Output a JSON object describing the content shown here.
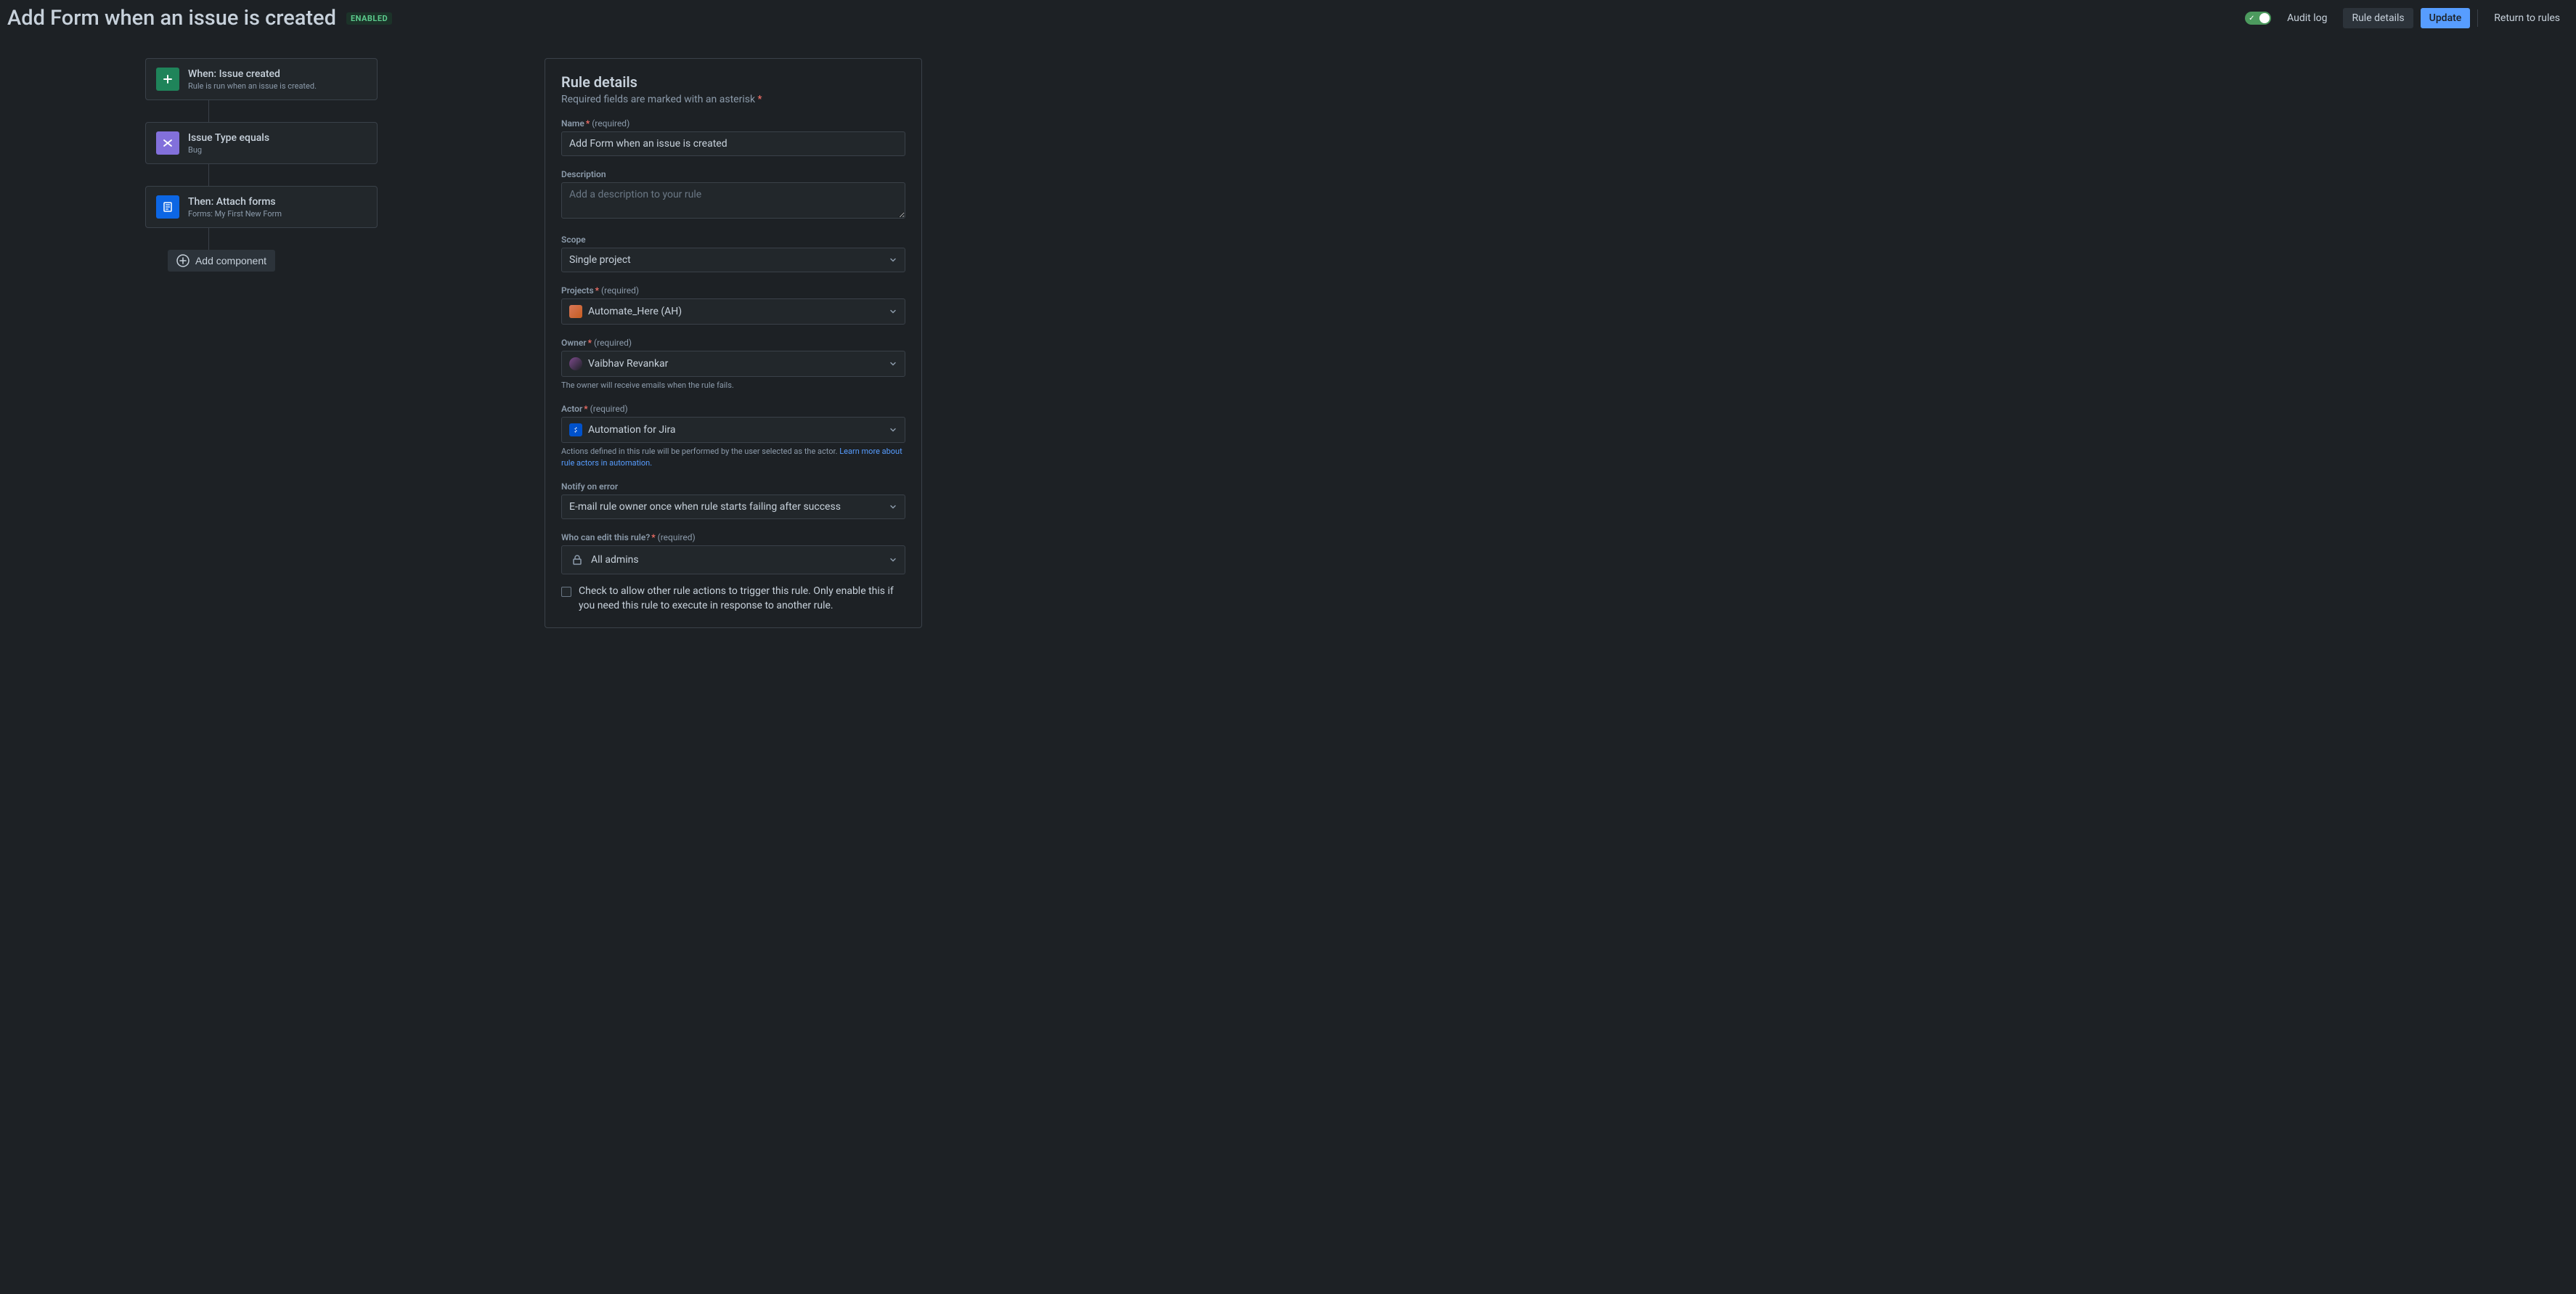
{
  "header": {
    "title": "Add Form when an issue is created",
    "enabled_badge": "ENABLED",
    "audit_log": "Audit log",
    "rule_details": "Rule details",
    "update": "Update",
    "return": "Return to rules"
  },
  "flow": {
    "trigger": {
      "title": "When: Issue created",
      "sub": "Rule is run when an issue is created."
    },
    "condition": {
      "title": "Issue Type equals",
      "sub": "Bug"
    },
    "action": {
      "title": "Then: Attach forms",
      "sub": "Forms: My First New Form"
    },
    "add_component": "Add component"
  },
  "details": {
    "panel_title": "Rule details",
    "required_note": "Required fields are marked with an asterisk",
    "name_label": "Name",
    "name_value": "Add Form when an issue is created",
    "description_label": "Description",
    "description_placeholder": "Add a description to your rule",
    "scope_label": "Scope",
    "scope_value": "Single project",
    "projects_label": "Projects",
    "projects_value": "Automate_Here (AH)",
    "owner_label": "Owner",
    "owner_value": "Vaibhav Revankar",
    "owner_help": "The owner will receive emails when the rule fails.",
    "actor_label": "Actor",
    "actor_value": "Automation for Jira",
    "actor_help_prefix": "Actions defined in this rule will be performed by the user selected as the actor. ",
    "actor_help_link": "Learn more about rule actors in automation.",
    "notify_label": "Notify on error",
    "notify_value": "E-mail rule owner once when rule starts failing after success",
    "who_label": "Who can edit this rule?",
    "who_value": "All admins",
    "required_tag": "(required)",
    "checkbox_label": "Check to allow other rule actions to trigger this rule. Only enable this if you need this rule to execute in response to another rule."
  }
}
